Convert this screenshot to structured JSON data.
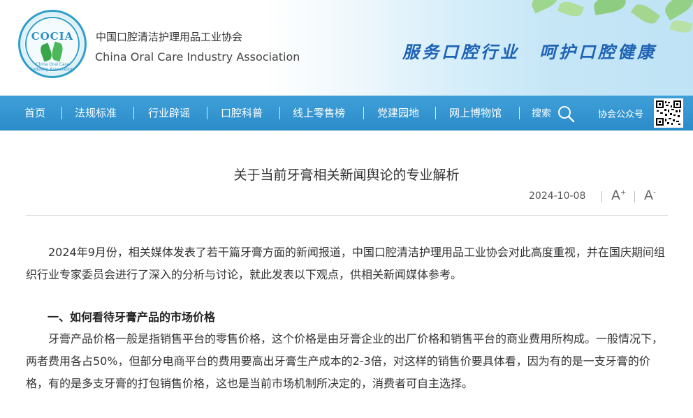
{
  "header": {
    "logo_acronym": "COCIA",
    "logo_ring_text": "China Oral Care Industry Association",
    "org_name_cn": "中国口腔清洁护理用品工业协会",
    "org_name_en": "China Oral Care Industry Association",
    "slogan": "服务口腔行业　呵护口腔健康"
  },
  "nav": {
    "items": [
      "首页",
      "法规标准",
      "行业辟谣",
      "口腔科普",
      "线上零售榜",
      "党建园地",
      "网上博物馆"
    ],
    "search_label": "搜索",
    "wechat_label": "协会公众号"
  },
  "article": {
    "title": "关于当前牙膏相关新闻舆论的专业解析",
    "date": "2024-10-08",
    "font_increase": "A",
    "font_decrease": "A",
    "paragraphs": [
      "2024年9月份，相关媒体发表了若干篇牙膏方面的新闻报道，中国口腔清洁护理用品工业协会对此高度重视，并在国庆期间组织行业专家委员会进行了深入的分析与讨论，就此发表以下观点，供相关新闻媒体参考。",
      "牙膏产品价格一般是指销售平台的零售价格，这个价格是由牙膏企业的出厂价格和销售平台的商业费用所构成。一般情况下，两者费用各占50%，但部分电商平台的费用要高出牙膏生产成本的2-3倍，对这样的销售价要具体看，因为有的是一支牙膏的价格，有的是多支牙膏的打包销售价格，这也是当前市场机制所决定的，消费者可自主选择。"
    ],
    "section_heading": "一、如何看待牙膏产品的市场价格"
  },
  "colors": {
    "nav_bg": "#2b8bca",
    "slogan": "#1e63b4",
    "logo_blue": "#2f9fc8",
    "logo_green": "#3aa64a"
  },
  "icons": [
    "search-icon",
    "qr-code-icon",
    "font-increase-icon",
    "font-decrease-icon",
    "logo-leaf-icon"
  ]
}
